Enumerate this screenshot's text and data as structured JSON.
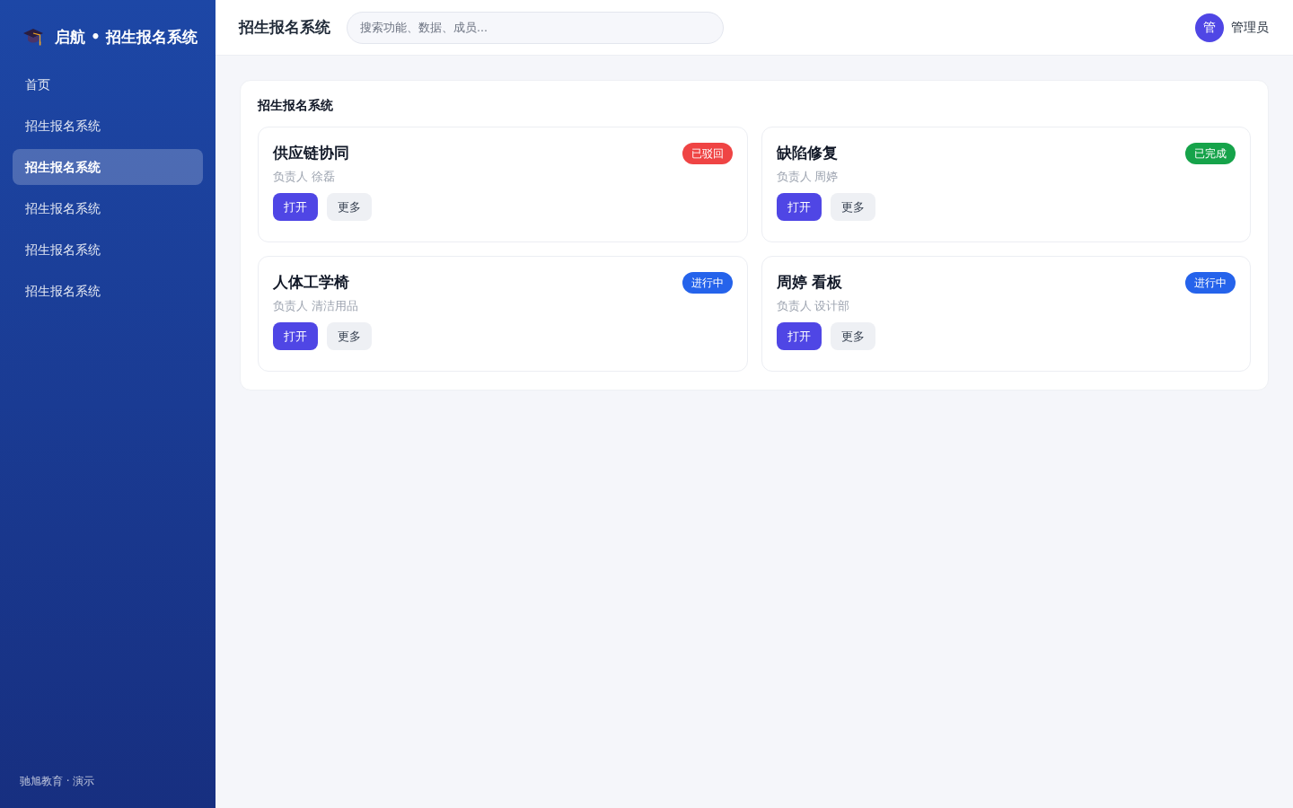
{
  "sidebar": {
    "brand": "启航 • 招生报名系统",
    "items": [
      {
        "label": "首页",
        "selected": false
      },
      {
        "label": "招生报名系统",
        "selected": false
      },
      {
        "label": "招生报名系统",
        "selected": true
      },
      {
        "label": "招生报名系统",
        "selected": false
      },
      {
        "label": "招生报名系统",
        "selected": false
      },
      {
        "label": "招生报名系统",
        "selected": false
      }
    ],
    "footer": "驰旭教育 · 演示"
  },
  "header": {
    "title": "招生报名系统",
    "search": {
      "placeholder": "搜索功能、数据、成员..."
    },
    "user": {
      "avatar": "管",
      "name": "管理员"
    }
  },
  "panel": {
    "title": "招生报名系统",
    "cards": [
      {
        "title": "供应链协同",
        "owner": "负责人 徐磊",
        "status": "已驳回",
        "color": "#ef4444",
        "buttons": [
          {
            "label": "打开",
            "kind": "primary"
          },
          {
            "label": "更多",
            "kind": "secondary"
          }
        ]
      },
      {
        "title": "缺陷修复",
        "owner": "负责人 周婷",
        "status": "已完成",
        "color": "#16a34a",
        "buttons": [
          {
            "label": "打开",
            "kind": "primary"
          },
          {
            "label": "更多",
            "kind": "secondary"
          }
        ]
      },
      {
        "title": "人体工学椅",
        "owner": "负责人 清洁用品",
        "status": "进行中",
        "color": "#2563eb",
        "buttons": [
          {
            "label": "打开",
            "kind": "primary"
          },
          {
            "label": "更多",
            "kind": "secondary"
          }
        ]
      },
      {
        "title": "周婷 看板",
        "owner": "负责人 设计部",
        "status": "进行中",
        "color": "#2563eb",
        "buttons": [
          {
            "label": "打开",
            "kind": "primary"
          },
          {
            "label": "更多",
            "kind": "secondary"
          }
        ]
      }
    ]
  }
}
